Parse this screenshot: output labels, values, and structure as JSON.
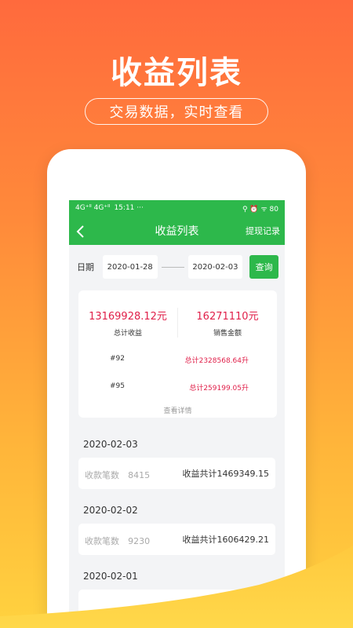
{
  "hero": {
    "title": "收益列表",
    "subtitle": "交易数据，实时查看"
  },
  "statusbar": {
    "signal_left": "4G⁺ᴵᴵ 4G⁺ᴵᴵ",
    "time": "15:11 ···",
    "right": "⚲ ⏰ ᯤ 80"
  },
  "navbar": {
    "back_icon": "chevron-left-icon",
    "title": "收益列表",
    "action": "提现记录"
  },
  "filter": {
    "date_label": "日期",
    "start_date": "2020-01-28",
    "end_date": "2020-02-03",
    "query_label": "查询"
  },
  "summary": {
    "total_income": "13169928.12元",
    "total_income_label": "总计收益",
    "sales_amount": "16271110元",
    "sales_amount_label": "销售金额",
    "fuels": [
      {
        "name": "#92",
        "value": "总计2328568.64升"
      },
      {
        "name": "#95",
        "value": "总计259199.05升"
      }
    ],
    "detail_link": "查看详情"
  },
  "days": [
    {
      "date": "2020-02-03",
      "count_label": "收款笔数",
      "count": "8415",
      "total": "收益共计1469349.15"
    },
    {
      "date": "2020-02-02",
      "count_label": "收款笔数",
      "count": "9230",
      "total": "收益共计1606429.21"
    },
    {
      "date": "2020-02-01",
      "count_label": "",
      "count": "",
      "total": ""
    }
  ],
  "colors": {
    "accent_green": "#2db84b",
    "amount_red": "#e0204a",
    "bg_gradient_top": "#ff6a3d",
    "bg_gradient_bottom": "#ffd23f"
  }
}
